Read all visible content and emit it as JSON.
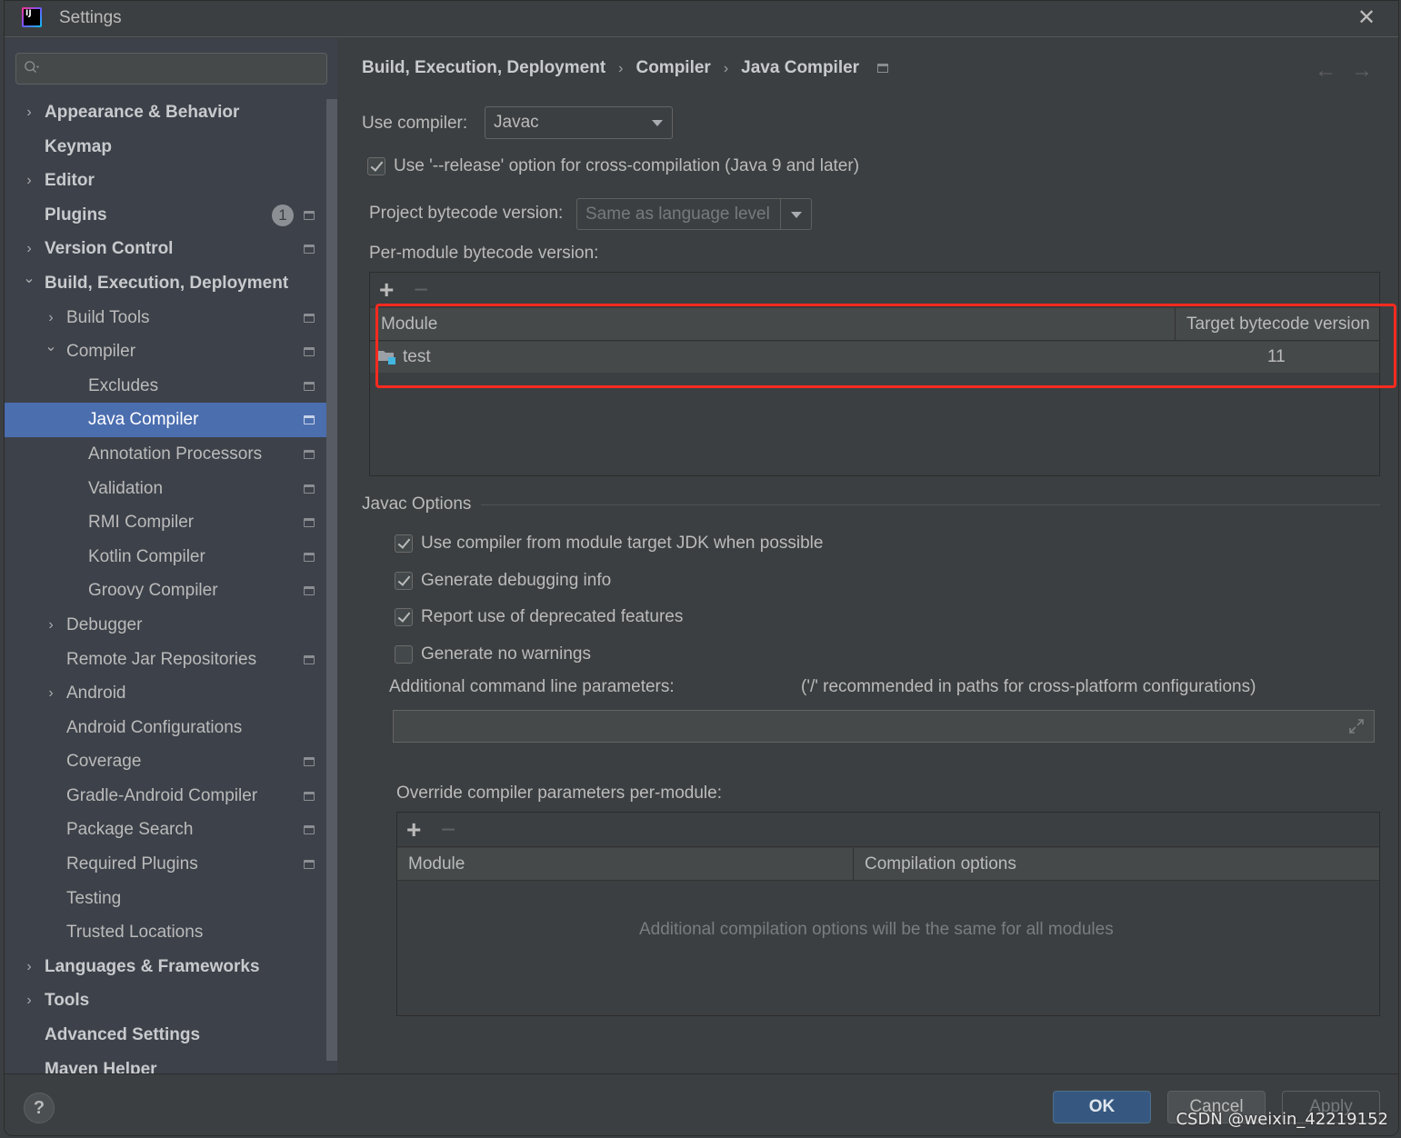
{
  "window": {
    "title": "Settings",
    "logo_text": "IJ"
  },
  "sidebar": {
    "search_placeholder": "",
    "items": [
      {
        "label": "Appearance & Behavior",
        "level": 0,
        "bold": true,
        "expander": "collapsed",
        "project_icon": false
      },
      {
        "label": "Keymap",
        "level": 0,
        "bold": true,
        "expander": "none",
        "project_icon": false
      },
      {
        "label": "Editor",
        "level": 0,
        "bold": true,
        "expander": "collapsed",
        "project_icon": false
      },
      {
        "label": "Plugins",
        "level": 0,
        "bold": true,
        "expander": "none",
        "project_icon": true,
        "badge": "1"
      },
      {
        "label": "Version Control",
        "level": 0,
        "bold": true,
        "expander": "collapsed",
        "project_icon": true
      },
      {
        "label": "Build, Execution, Deployment",
        "level": 0,
        "bold": true,
        "expander": "expanded",
        "project_icon": false
      },
      {
        "label": "Build Tools",
        "level": 1,
        "bold": false,
        "expander": "collapsed",
        "project_icon": true
      },
      {
        "label": "Compiler",
        "level": 1,
        "bold": false,
        "expander": "expanded",
        "project_icon": true
      },
      {
        "label": "Excludes",
        "level": 2,
        "bold": false,
        "expander": "none",
        "project_icon": true
      },
      {
        "label": "Java Compiler",
        "level": 2,
        "bold": false,
        "expander": "none",
        "project_icon": true,
        "selected": true
      },
      {
        "label": "Annotation Processors",
        "level": 2,
        "bold": false,
        "expander": "none",
        "project_icon": true
      },
      {
        "label": "Validation",
        "level": 2,
        "bold": false,
        "expander": "none",
        "project_icon": true
      },
      {
        "label": "RMI Compiler",
        "level": 2,
        "bold": false,
        "expander": "none",
        "project_icon": true
      },
      {
        "label": "Kotlin Compiler",
        "level": 2,
        "bold": false,
        "expander": "none",
        "project_icon": true
      },
      {
        "label": "Groovy Compiler",
        "level": 2,
        "bold": false,
        "expander": "none",
        "project_icon": true
      },
      {
        "label": "Debugger",
        "level": 1,
        "bold": false,
        "expander": "collapsed",
        "project_icon": false
      },
      {
        "label": "Remote Jar Repositories",
        "level": 1,
        "bold": false,
        "expander": "none",
        "project_icon": true
      },
      {
        "label": "Android",
        "level": 1,
        "bold": false,
        "expander": "collapsed",
        "project_icon": false
      },
      {
        "label": "Android Configurations",
        "level": 1,
        "bold": false,
        "expander": "none",
        "project_icon": false
      },
      {
        "label": "Coverage",
        "level": 1,
        "bold": false,
        "expander": "none",
        "project_icon": true
      },
      {
        "label": "Gradle-Android Compiler",
        "level": 1,
        "bold": false,
        "expander": "none",
        "project_icon": true
      },
      {
        "label": "Package Search",
        "level": 1,
        "bold": false,
        "expander": "none",
        "project_icon": true
      },
      {
        "label": "Required Plugins",
        "level": 1,
        "bold": false,
        "expander": "none",
        "project_icon": true
      },
      {
        "label": "Testing",
        "level": 1,
        "bold": false,
        "expander": "none",
        "project_icon": false
      },
      {
        "label": "Trusted Locations",
        "level": 1,
        "bold": false,
        "expander": "none",
        "project_icon": false
      },
      {
        "label": "Languages & Frameworks",
        "level": 0,
        "bold": true,
        "expander": "collapsed",
        "project_icon": false
      },
      {
        "label": "Tools",
        "level": 0,
        "bold": true,
        "expander": "collapsed",
        "project_icon": false
      },
      {
        "label": "Advanced Settings",
        "level": 0,
        "bold": true,
        "expander": "none",
        "project_icon": false
      },
      {
        "label": "Maven Helper",
        "level": 0,
        "bold": true,
        "expander": "none",
        "project_icon": false
      }
    ]
  },
  "main": {
    "breadcrumb": [
      "Build, Execution, Deployment",
      "Compiler",
      "Java Compiler"
    ],
    "breadcrumb_separator": "›",
    "nav_back": "←",
    "nav_forward": "→",
    "use_compiler_label": "Use compiler:",
    "use_compiler_value": "Javac",
    "release_option": {
      "label": "Use '--release' option for cross-compilation (Java 9 and later)",
      "checked": true
    },
    "project_bytecode_label": "Project bytecode version:",
    "project_bytecode_value": "Same as language level",
    "per_module_label": "Per-module bytecode version:",
    "per_module_table": {
      "add": "+",
      "remove": "−",
      "columns": [
        "Module",
        "Target bytecode version"
      ],
      "rows": [
        {
          "module": "test",
          "target": "11"
        }
      ]
    },
    "javac_options": {
      "title": "Javac Options",
      "checkboxes": [
        {
          "label": "Use compiler from module target JDK when possible",
          "checked": true
        },
        {
          "label": "Generate debugging info",
          "checked": true
        },
        {
          "label": "Report use of deprecated features",
          "checked": true
        },
        {
          "label": "Generate no warnings",
          "checked": false
        }
      ],
      "additional_params_label": "Additional command line parameters:",
      "additional_params_hint": "('/' recommended in paths for cross-platform configurations)",
      "additional_params_value": ""
    },
    "override": {
      "label": "Override compiler parameters per-module:",
      "add": "+",
      "remove": "−",
      "columns": [
        "Module",
        "Compilation options"
      ],
      "empty_text": "Additional compilation options will be the same for all modules"
    },
    "highlight_color": "#ff2a1f"
  },
  "footer": {
    "help": "?",
    "ok": "OK",
    "cancel": "Cancel",
    "apply": "Apply"
  },
  "watermark": "CSDN @weixin_42219152",
  "colors": {
    "selection": "#4b6eaf",
    "ok_button": "#365880",
    "background": "#3c3f41",
    "sidebar": "#3d4149"
  }
}
